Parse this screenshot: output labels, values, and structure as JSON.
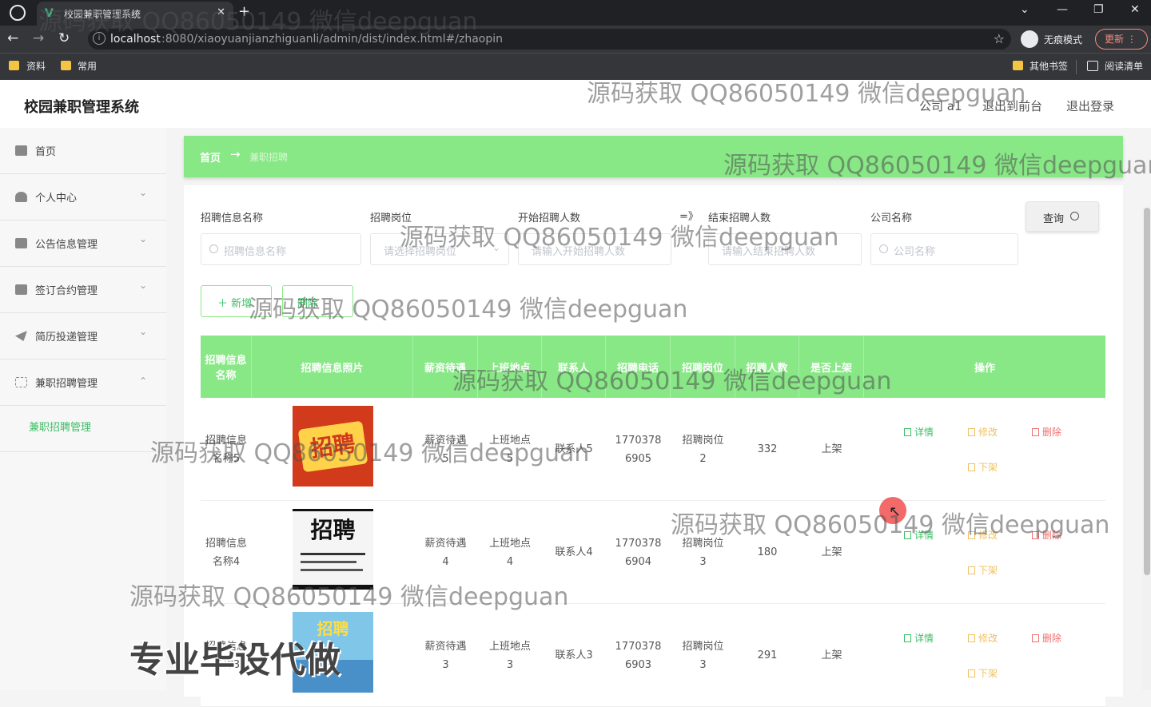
{
  "browser": {
    "tab_title": "校园兼职管理系统",
    "tab_close": "✕",
    "new_tab": "+",
    "url_host": "localhost",
    "url_path": ":8080/xiaoyuanjianzhiguanli/admin/dist/index.html#/zhaopin",
    "incognito_label": "无痕模式",
    "update_label": "更新 ⋮",
    "bookmarks": [
      "资料",
      "常用",
      "其他书签",
      "阅读清单"
    ],
    "window_controls": [
      "⌄",
      "—",
      "❐",
      "✕"
    ]
  },
  "header": {
    "title": "校园兼职管理系统",
    "user": "公司 a1",
    "to_front": "退出到前台",
    "logout": "退出登录"
  },
  "sidebar": {
    "items": [
      {
        "label": "首页",
        "icon": "home-icon"
      },
      {
        "label": "个人中心",
        "icon": "user-icon"
      },
      {
        "label": "公告信息管理",
        "icon": "megaphone-icon"
      },
      {
        "label": "签订合约管理",
        "icon": "contract-icon"
      },
      {
        "label": "简历投递管理",
        "icon": "send-icon"
      },
      {
        "label": "兼职招聘管理",
        "icon": "expand-icon"
      }
    ],
    "sub_item": "兼职招聘管理"
  },
  "breadcrumb": {
    "home": "首页",
    "arrow": "→",
    "current": "兼职招聘"
  },
  "filters": {
    "name_label": "招聘信息名称",
    "name_placeholder": "招聘信息名称",
    "position_label": "招聘岗位",
    "position_placeholder": "请选择招聘岗位",
    "start_label": "开始招聘人数",
    "start_placeholder": "请输入开始招聘人数",
    "range_sep": "=》",
    "end_label": "结束招聘人数",
    "end_placeholder": "请输入结束招聘人数",
    "company_label": "公司名称",
    "company_placeholder": "公司名称",
    "query_label": "查询"
  },
  "actions": {
    "add": "＋ 新增",
    "delete": "删除"
  },
  "table": {
    "columns": [
      "招聘信息名称",
      "招聘信息照片",
      "薪资待遇",
      "上班地点",
      "联系人",
      "招聘电话",
      "招聘岗位",
      "招聘人数",
      "是否上架",
      "操作"
    ],
    "rows": [
      {
        "name": [
          "招聘信息",
          "名称5"
        ],
        "salary": [
          "薪资待遇",
          "5"
        ],
        "location": [
          "上班地点",
          "5"
        ],
        "contact": "联系人5",
        "phone": [
          "1770378",
          "6905"
        ],
        "position": [
          "招聘岗位",
          "2"
        ],
        "count": "332",
        "status": "上架"
      },
      {
        "name": [
          "招聘信息",
          "名称4"
        ],
        "salary": [
          "薪资待遇",
          "4"
        ],
        "location": [
          "上班地点",
          "4"
        ],
        "contact": "联系人4",
        "phone": [
          "1770378",
          "6904"
        ],
        "position": [
          "招聘岗位",
          "3"
        ],
        "count": "180",
        "status": "上架"
      },
      {
        "name": [
          "招聘信息",
          "名称3"
        ],
        "salary": [
          "薪资待遇",
          "3"
        ],
        "location": [
          "上班地点",
          "3"
        ],
        "contact": "联系人3",
        "phone": [
          "1770378",
          "6903"
        ],
        "position": [
          "招聘岗位",
          "3"
        ],
        "count": "291",
        "status": "上架"
      }
    ],
    "ops": {
      "detail": "详情",
      "edit": "修改",
      "del": "删除",
      "down": "下架"
    }
  },
  "thumbnails": [
    {
      "text": "招聘",
      "bg": "#d23a1c",
      "fg": "#ffd24a"
    },
    {
      "text": "招聘",
      "bg": "#f5f5f5",
      "fg": "#111111"
    },
    {
      "text": "招聘",
      "bg": "#7fc6e8",
      "fg": "#ffffff"
    }
  ],
  "watermark": {
    "text": "源码获取 QQ86050149 微信deepguan",
    "promo": "专业毕设代做"
  },
  "colors": {
    "accent": "#88e886",
    "accent_text": "#3cbf66"
  }
}
